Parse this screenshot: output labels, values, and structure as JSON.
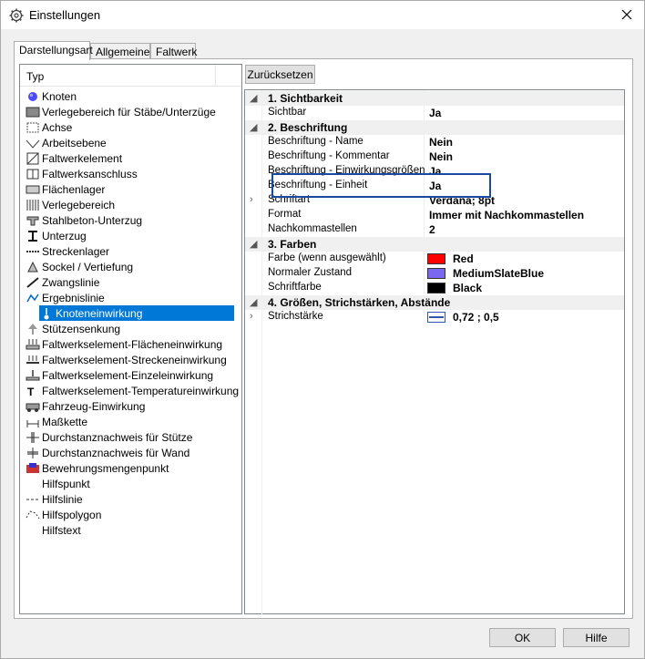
{
  "window": {
    "title": "Einstellungen"
  },
  "tabs": [
    {
      "label": "Darstellungsart",
      "active": true
    },
    {
      "label": "Allgemeines",
      "active": false
    },
    {
      "label": "Faltwerk",
      "active": false
    }
  ],
  "type_list": {
    "header": "Typ",
    "selected": "Knoteneinwirkung",
    "items": [
      {
        "label": "Knoten",
        "icon": "node-sphere-icon"
      },
      {
        "label": "Verlegebereich für Stäbe/Unterzüge",
        "icon": "area-icon"
      },
      {
        "label": "Achse",
        "icon": "axis-icon"
      },
      {
        "label": "Arbeitsebene",
        "icon": "work-plane-icon"
      },
      {
        "label": "Faltwerkelement",
        "icon": "folded-plate-icon"
      },
      {
        "label": "Faltwerksanschluss",
        "icon": "connection-icon"
      },
      {
        "label": "Flächenlager",
        "icon": "surface-support-icon"
      },
      {
        "label": "Verlegebereich",
        "icon": "hatched-area-icon"
      },
      {
        "label": "Stahlbeton-Unterzug",
        "icon": "beam-icon"
      },
      {
        "label": "Unterzug",
        "icon": "i-beam-icon"
      },
      {
        "label": "Streckenlager",
        "icon": "line-support-icon"
      },
      {
        "label": "Sockel / Vertiefung",
        "icon": "pedestal-icon"
      },
      {
        "label": "Zwangslinie",
        "icon": "constraint-line-icon"
      },
      {
        "label": "Ergebnislinie",
        "icon": "result-line-icon"
      },
      {
        "label": "Knoteneinwirkung",
        "icon": "node-load-icon"
      },
      {
        "label": "Stützensenkung",
        "icon": "settlement-icon"
      },
      {
        "label": "Faltwerkselement-Flächeneinwirkung",
        "icon": "area-load-icon"
      },
      {
        "label": "Faltwerkselement-Streckeneinwirkung",
        "icon": "line-load-icon"
      },
      {
        "label": "Faltwerkselement-Einzeleinwirkung",
        "icon": "point-load-icon"
      },
      {
        "label": "Faltwerkselement-Temperatureinwirkung",
        "icon": "temperature-icon"
      },
      {
        "label": "Fahrzeug-Einwirkung",
        "icon": "vehicle-icon"
      },
      {
        "label": "Maßkette",
        "icon": "dimension-icon"
      },
      {
        "label": "Durchstanznachweis für Stütze",
        "icon": "punching-column-icon"
      },
      {
        "label": "Durchstanznachweis für Wand",
        "icon": "punching-wall-icon"
      },
      {
        "label": "Bewehrungsmengenpunkt",
        "icon": "reinforcement-icon"
      },
      {
        "label": "Hilfspunkt",
        "icon": ""
      },
      {
        "label": "Hilfslinie",
        "icon": "helper-line-icon"
      },
      {
        "label": "Hilfspolygon",
        "icon": "helper-polygon-icon"
      },
      {
        "label": "Hilfstext",
        "icon": ""
      }
    ]
  },
  "reset_button": "Zurücksetzen",
  "properties": {
    "categories": [
      {
        "label": "1. Sichtbarkeit",
        "rows": [
          {
            "name": "Sichtbar",
            "value": "Ja"
          }
        ]
      },
      {
        "label": "2. Beschriftung",
        "rows": [
          {
            "name": "Beschriftung - Name",
            "value": "Nein"
          },
          {
            "name": "Beschriftung - Kommentar",
            "value": "Nein"
          },
          {
            "name": "Beschriftung - Einwirkungsgrößen",
            "value": "Ja"
          },
          {
            "name": "Beschriftung - Einheit",
            "value": "Ja"
          },
          {
            "name": "Schriftart",
            "value": "Verdana; 8pt"
          },
          {
            "name": "Format",
            "value": "Immer mit Nachkommastellen"
          },
          {
            "name": "Nachkommastellen",
            "value": "2"
          }
        ]
      },
      {
        "label": "3. Farben",
        "rows": [
          {
            "name": "Farbe (wenn ausgewählt)",
            "value": "Red",
            "color": "#ff0000"
          },
          {
            "name": "Normaler Zustand",
            "value": "MediumSlateBlue",
            "color": "#7b68ee"
          },
          {
            "name": "Schriftfarbe",
            "value": "Black",
            "color": "#000000"
          }
        ]
      },
      {
        "label": "4. Größen, Strichstärken, Abstände",
        "rows": [
          {
            "name": "Strichstärke",
            "value": "0,72 ; 0,5"
          }
        ]
      }
    ]
  },
  "footer": {
    "ok": "OK",
    "help": "Hilfe"
  }
}
